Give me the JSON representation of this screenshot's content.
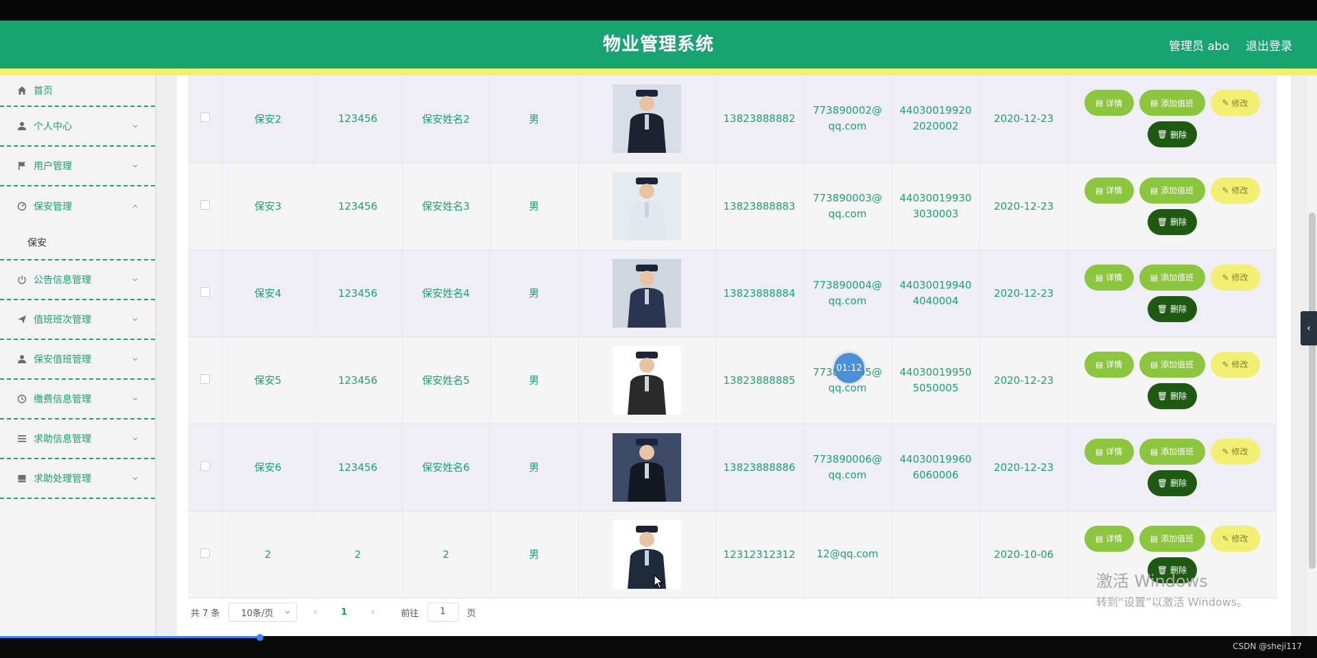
{
  "header": {
    "title": "物业管理系统",
    "user_label": "管理员 abo",
    "logout_label": "退出登录"
  },
  "sidebar": {
    "items": [
      {
        "label": "首页",
        "icon": "home-icon"
      },
      {
        "label": "个人中心",
        "icon": "user-icon"
      },
      {
        "label": "用户管理",
        "icon": "flag-icon"
      },
      {
        "label": "保安管理",
        "icon": "dashboard-icon",
        "expanded": true
      },
      {
        "label": "公告信息管理",
        "icon": "power-icon"
      },
      {
        "label": "值班班次管理",
        "icon": "send-icon"
      },
      {
        "label": "保安值班管理",
        "icon": "user-icon"
      },
      {
        "label": "缴费信息管理",
        "icon": "clock-icon"
      },
      {
        "label": "求助信息管理",
        "icon": "list-icon"
      },
      {
        "label": "求助处理管理",
        "icon": "box-icon"
      }
    ],
    "submenu": {
      "label": "保安"
    }
  },
  "table": {
    "rows": [
      {
        "account": "保安2",
        "password": "123456",
        "name": "保安姓名2",
        "gender": "男",
        "phone": "13823888882",
        "email": "773890002@qq.com",
        "idcard": "440300199202020002",
        "date": "2020-12-23"
      },
      {
        "account": "保安3",
        "password": "123456",
        "name": "保安姓名3",
        "gender": "男",
        "phone": "13823888883",
        "email": "773890003@qq.com",
        "idcard": "440300199303030003",
        "date": "2020-12-23"
      },
      {
        "account": "保安4",
        "password": "123456",
        "name": "保安姓名4",
        "gender": "男",
        "phone": "13823888884",
        "email": "773890004@qq.com",
        "idcard": "440300199404040004",
        "date": "2020-12-23"
      },
      {
        "account": "保安5",
        "password": "123456",
        "name": "保安姓名5",
        "gender": "男",
        "phone": "13823888885",
        "email": "773890005@qq.com",
        "idcard": "440300199505050005",
        "date": "2020-12-23"
      },
      {
        "account": "保安6",
        "password": "123456",
        "name": "保安姓名6",
        "gender": "男",
        "phone": "13823888886",
        "email": "773890006@qq.com",
        "idcard": "440300199606060006",
        "date": "2020-12-23"
      },
      {
        "account": "2",
        "password": "2",
        "name": "2",
        "gender": "男",
        "phone": "12312312312",
        "email": "12@qq.com",
        "idcard": "",
        "date": "2020-10-06"
      }
    ],
    "actions": {
      "detail": "详情",
      "add_shift": "添加值班",
      "edit": "修改",
      "delete": "删除"
    }
  },
  "pagination": {
    "total": "共 7 条",
    "page_size": "10条/页",
    "current_page": "1",
    "goto_prefix": "前往",
    "goto_value": "1",
    "goto_suffix": "页"
  },
  "overlay": {
    "timer": "01:12",
    "watermark_line1": "激活 Windows",
    "watermark_line2": "转到“设置”以激活 Windows。",
    "credit": "CSDN @sheji117"
  },
  "colors": {
    "primary": "#1aa372",
    "accent_yellow": "#f3f06c",
    "btn_green": "#8cc63f",
    "btn_dark": "#1e5a12"
  }
}
